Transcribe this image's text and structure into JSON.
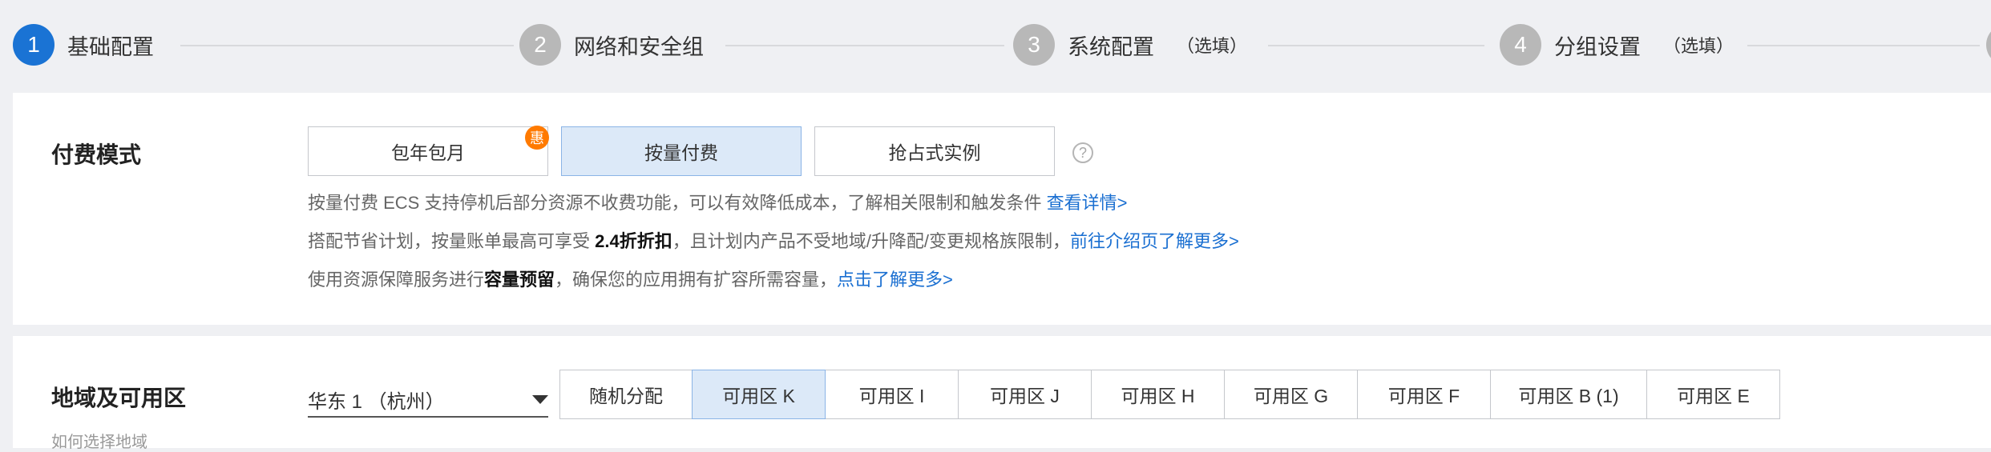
{
  "steps": [
    {
      "num": "1",
      "label": "基础配置",
      "optional": ""
    },
    {
      "num": "2",
      "label": "网络和安全组",
      "optional": ""
    },
    {
      "num": "3",
      "label": "系统配置",
      "optional": "（选填）"
    },
    {
      "num": "4",
      "label": "分组设置",
      "optional": "（选填）"
    }
  ],
  "payment": {
    "title": "付费模式",
    "options": [
      "包年包月",
      "按量付费",
      "抢占式实例"
    ],
    "selected": "按量付费",
    "badge": "惠",
    "help": "?",
    "lines": [
      {
        "text": "按量付费 ECS 支持停机后部分资源不收费功能，可以有效降低成本，了解相关限制和触发条件 ",
        "link": "查看详情>"
      },
      {
        "pre": "搭配节省计划，按量账单最高可享受 ",
        "bold": "2.4折折扣",
        "post": "，且计划内产品不受地域/升降配/变更规格族限制，",
        "link": "前往介绍页了解更多>"
      },
      {
        "pre": "使用资源保障服务进行",
        "bold": "容量预留",
        "post": "，确保您的应用拥有扩容所需容量，",
        "link": "点击了解更多>"
      }
    ]
  },
  "region": {
    "title": "地域及可用区",
    "selected_region": "华东 1 （杭州）",
    "zones": [
      "随机分配",
      "可用区 K",
      "可用区 I",
      "可用区 J",
      "可用区 H",
      "可用区 G",
      "可用区 F",
      "可用区 B (1)",
      "可用区 E"
    ],
    "selected_zone": "可用区 K",
    "hint": "如何选择地域"
  }
}
